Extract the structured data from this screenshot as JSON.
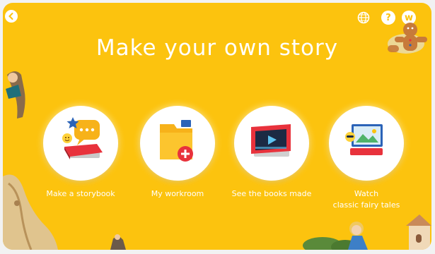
{
  "header": {
    "title": "Make your own story",
    "help_label": "?",
    "user_initial": "w"
  },
  "menu": [
    {
      "id": "make-storybook",
      "label": "Make a storybook"
    },
    {
      "id": "my-workroom",
      "label": "My workroom"
    },
    {
      "id": "books-made",
      "label": "See the books made"
    },
    {
      "id": "watch-fairy-tales",
      "label": "Watch\nclassic fairy tales"
    }
  ],
  "colors": {
    "background": "#fcc30e",
    "card": "#ffffff",
    "accent_red": "#e8323c",
    "accent_blue": "#2b63b8"
  },
  "icons": {
    "back": "back-arrow-icon",
    "language": "globe-icon",
    "help": "help-icon",
    "profile": "user-avatar-icon"
  }
}
